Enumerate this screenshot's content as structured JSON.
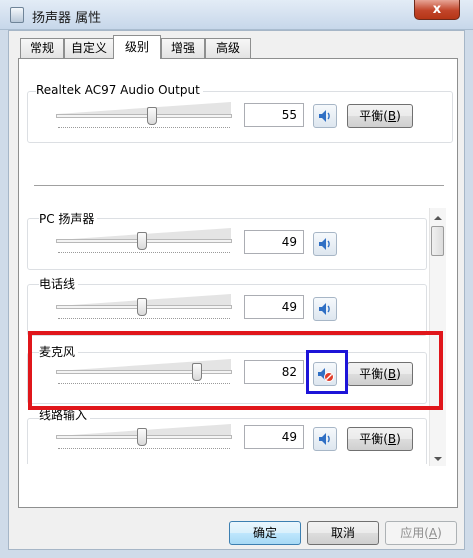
{
  "window": {
    "title": "扬声器 属性",
    "close_label": "x"
  },
  "tabs": [
    {
      "label": "常规",
      "active": false
    },
    {
      "label": "自定义",
      "active": false
    },
    {
      "label": "级别",
      "active": true
    },
    {
      "label": "增强",
      "active": false
    },
    {
      "label": "高级",
      "active": false
    }
  ],
  "main_output": {
    "label": "Realtek AC97 Audio Output",
    "value": "55",
    "level": 55,
    "balance_label": "平衡",
    "balance_key": "B",
    "muted": false
  },
  "devices": [
    {
      "label": "PC 扬声器",
      "value": "49",
      "level": 49,
      "muted": false,
      "balance_label": "",
      "balance_key": ""
    },
    {
      "label": "电话线",
      "value": "49",
      "level": 49,
      "muted": false,
      "balance_label": "",
      "balance_key": ""
    },
    {
      "label": "麦克风",
      "value": "82",
      "level": 82,
      "muted": true,
      "balance_label": "平衡",
      "balance_key": "B"
    },
    {
      "label": "线路输入",
      "value": "49",
      "level": 49,
      "muted": false,
      "balance_label": "平衡",
      "balance_key": "B"
    }
  ],
  "footer": {
    "ok_label": "确定",
    "cancel_label": "取消",
    "apply_label": "应用",
    "apply_key": "A"
  },
  "icons": {
    "speaker": "speaker-icon",
    "speaker_muted": "speaker-muted-icon",
    "scroll_up": "scroll-up-arrow-icon",
    "scroll_down": "scroll-down-arrow-icon"
  },
  "colors": {
    "annotation_red": "#e0161b",
    "annotation_blue": "#1d14d8",
    "mute_badge": "#e03c2a"
  }
}
